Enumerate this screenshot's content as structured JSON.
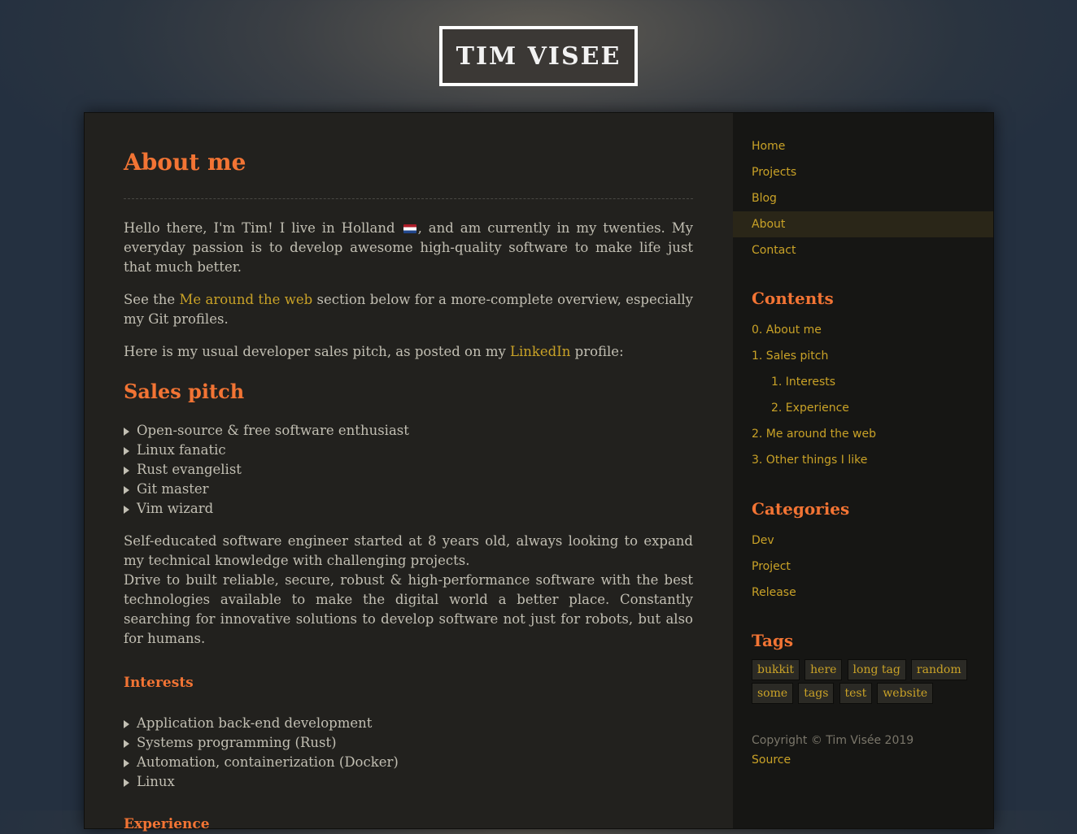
{
  "logo": "TIM VISEE",
  "main": {
    "title": "About me",
    "intro_p1_a": "Hello there, I'm Tim! I live in Holland ",
    "intro_p1_b": ", and am currently in my twenties. My everyday passion is to develop awesome high-quality software to make life just that much better.",
    "intro_p2_a": "See the ",
    "intro_p2_link": "Me around the web",
    "intro_p2_b": " section below for a more-complete overview, especially my Git profiles.",
    "intro_p3_a": "Here is my usual developer sales pitch, as posted on my ",
    "intro_p3_link": "LinkedIn",
    "intro_p3_b": " profile:",
    "sales_title": "Sales pitch",
    "pitch": [
      "Open-source & free software enthusiast",
      "Linux fanatic",
      "Rust evangelist",
      "Git master",
      "Vim wizard"
    ],
    "summary_1": "Self-educated software engineer started at 8 years old, always looking to expand my technical knowledge with challenging projects.",
    "summary_2": "Drive to built reliable, secure, robust & high-performance software with the best technologies available to make the digital world a better place. Constantly searching for innovative solutions to develop software not just for robots, but also for humans.",
    "interests_title": "Interests",
    "interests": [
      "Application back-end development",
      "Systems programming (Rust)",
      "Automation, containerization (Docker)",
      "Linux"
    ],
    "experience_title": "Experience"
  },
  "sidebar": {
    "nav": [
      "Home",
      "Projects",
      "Blog",
      "About",
      "Contact"
    ],
    "contents_title": "Contents",
    "contents": [
      "0. About me",
      "1. Sales pitch",
      "1. Interests",
      "2. Experience",
      "2. Me around the web",
      "3. Other things I like"
    ],
    "categories_title": "Categories",
    "categories": [
      "Dev",
      "Project",
      "Release"
    ],
    "tags_title": "Tags",
    "tags": [
      "bukkit",
      "here",
      "long tag",
      "random",
      "some",
      "tags",
      "test",
      "website"
    ],
    "copyright": "Copyright © Tim Visée 2019",
    "source": "Source"
  },
  "colors": {
    "accent": "#f27434",
    "link": "#c9a227",
    "text": "#c2bfb3"
  },
  "icons": [
    "netherlands-flag-icon",
    "bullet-triangle-icon"
  ]
}
